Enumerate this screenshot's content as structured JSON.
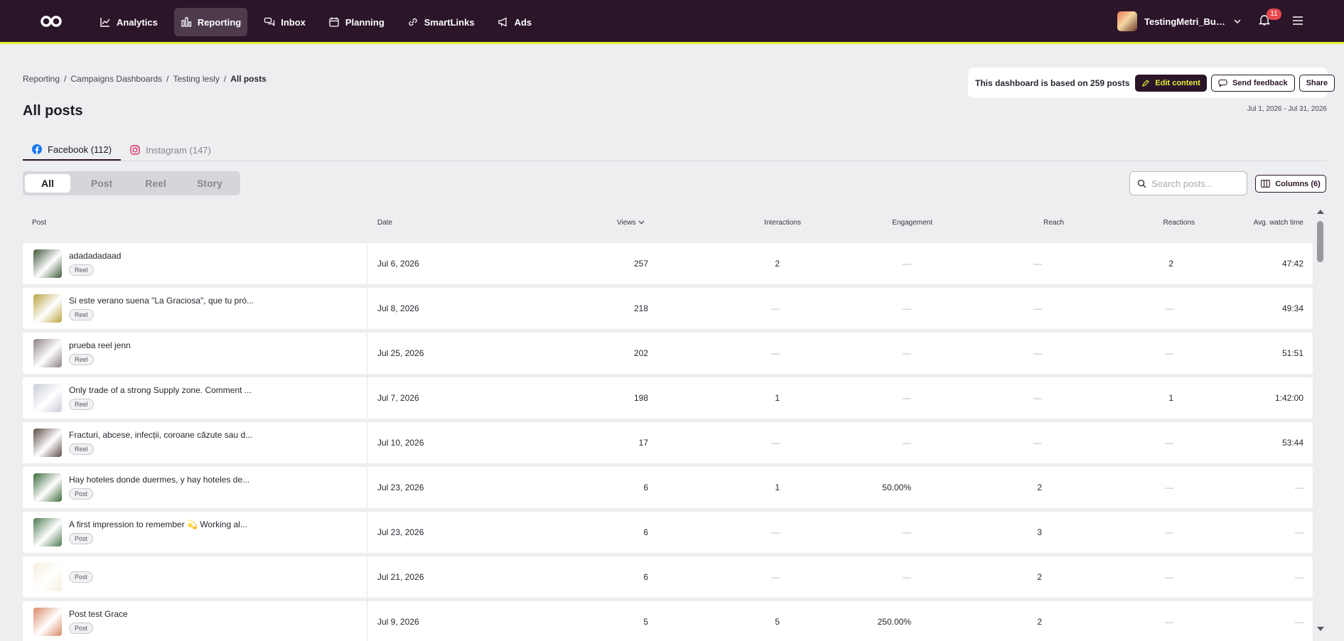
{
  "nav": {
    "items": [
      {
        "label": "Analytics",
        "icon": "chart-line-icon"
      },
      {
        "label": "Reporting",
        "icon": "bar-chart-icon",
        "active": true
      },
      {
        "label": "Inbox",
        "icon": "chat-bubbles-icon"
      },
      {
        "label": "Planning",
        "icon": "calendar-icon"
      },
      {
        "label": "SmartLinks",
        "icon": "link-icon"
      },
      {
        "label": "Ads",
        "icon": "megaphone-icon"
      }
    ],
    "account_name": "TestingMetri_Busin...",
    "notification_count": "11"
  },
  "breadcrumb": [
    "Reporting",
    "/",
    "Campaigns Dashboards",
    "/",
    "Testing lesly",
    "/",
    "All posts"
  ],
  "page": {
    "title": "All posts",
    "info_text": "This dashboard is based on 259 posts",
    "edit_label": "Edit content",
    "feedback_label": "Send feedback",
    "share_label": "Share",
    "date_range": "Jul 1, 2026 - Jul 31, 2026"
  },
  "tabs": [
    {
      "label": "Facebook (112)",
      "active": true
    },
    {
      "label": "Instagram (147)",
      "active": false
    }
  ],
  "filters": [
    "All",
    "Post",
    "Reel",
    "Story"
  ],
  "search": {
    "placeholder": "Search posts..."
  },
  "columns_label": "Columns (6)",
  "table": {
    "headers": [
      "Post",
      "Date",
      "Views",
      "Interactions",
      "Engagement",
      "Reach",
      "Reactions",
      "Avg. watch time"
    ],
    "rows": [
      {
        "title": "adadadadaad",
        "type": "Reel",
        "date": "Jul 6, 2026",
        "views": "257",
        "interactions": "2",
        "engagement": "—",
        "reach": "—",
        "reactions": "2",
        "watch": "47:42",
        "thumb": "#3f5a3a"
      },
      {
        "title": "Si este verano suena \"La Graciosa\", que tu pró...",
        "type": "Reel",
        "date": "Jul 8, 2026",
        "views": "218",
        "interactions": "—",
        "engagement": "—",
        "reach": "—",
        "reactions": "—",
        "watch": "49:34",
        "thumb": "#b8a540"
      },
      {
        "title": "prueba reel jenn",
        "type": "Reel",
        "date": "Jul 25, 2026",
        "views": "202",
        "interactions": "—",
        "engagement": "—",
        "reach": "—",
        "reactions": "—",
        "watch": "51:51",
        "thumb": "#8d7f86"
      },
      {
        "title": "Only trade of a strong Supply zone. Comment ...",
        "type": "Reel",
        "date": "Jul 7, 2026",
        "views": "198",
        "interactions": "1",
        "engagement": "—",
        "reach": "—",
        "reactions": "1",
        "watch": "1:42:00",
        "thumb": "#c9cdd8"
      },
      {
        "title": "Fracturi, abcese, infecții, coroane căzute sau d...",
        "type": "Reel",
        "date": "Jul 10, 2026",
        "views": "17",
        "interactions": "—",
        "engagement": "—",
        "reach": "—",
        "reactions": "—",
        "watch": "53:44",
        "thumb": "#5d4b48"
      },
      {
        "title": "Hay hoteles donde duermes, y hay hoteles de...",
        "type": "Post",
        "date": "Jul 23, 2026",
        "views": "6",
        "interactions": "1",
        "engagement": "50.00%",
        "reach": "2",
        "reactions": "—",
        "watch": "—",
        "thumb": "#3b6b3a"
      },
      {
        "title": "A first impression to remember 💫 Working al...",
        "type": "Post",
        "date": "Jul 23, 2026",
        "views": "6",
        "interactions": "—",
        "engagement": "—",
        "reach": "3",
        "reactions": "—",
        "watch": "—",
        "thumb": "#4f7a52"
      },
      {
        "title": "",
        "type": "Post",
        "date": "Jul 21, 2026",
        "views": "6",
        "interactions": "—",
        "engagement": "—",
        "reach": "2",
        "reactions": "—",
        "watch": "—",
        "thumb": "#f5efdc"
      },
      {
        "title": "Post test Grace",
        "type": "Post",
        "date": "Jul 9, 2026",
        "views": "5",
        "interactions": "5",
        "engagement": "250.00%",
        "reach": "2",
        "reactions": "—",
        "watch": "—",
        "thumb": "#d98a6a"
      }
    ]
  },
  "colors": {
    "nav_bg": "#2b1529",
    "accent": "#e7ec3a",
    "facebook": "#1877f2",
    "instagram": "#e1306c"
  }
}
